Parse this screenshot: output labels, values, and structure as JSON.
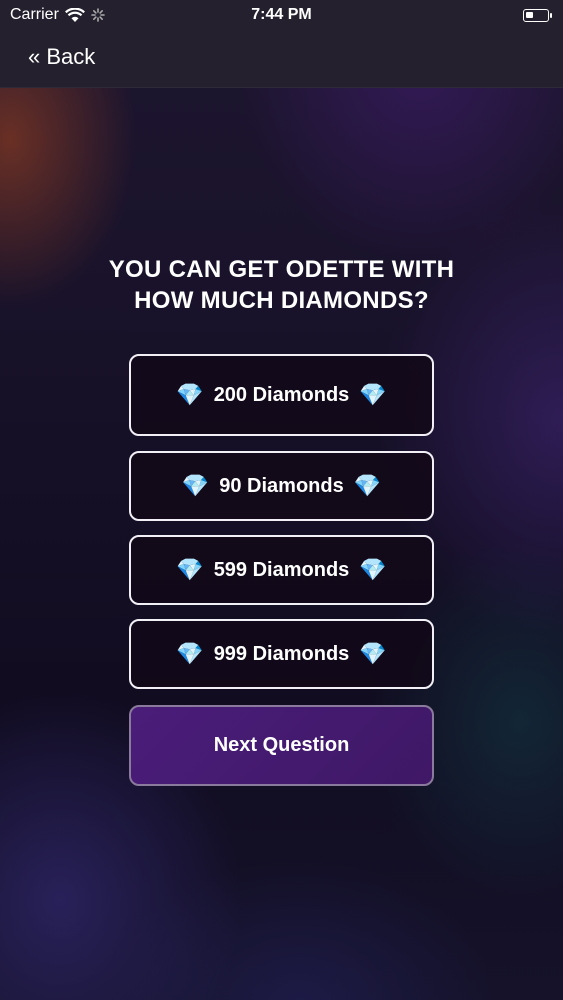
{
  "status_bar": {
    "carrier": "Carrier",
    "time": "7:44 PM"
  },
  "nav": {
    "back_label": "« Back"
  },
  "quiz": {
    "question": "YOU CAN GET ODETTE WITH HOW MUCH DIAMONDS?",
    "answers": [
      {
        "label": "200 Diamonds",
        "icon": "💎"
      },
      {
        "label": "90 Diamonds",
        "icon": "💎"
      },
      {
        "label": "599 Diamonds",
        "icon": "💎"
      },
      {
        "label": "999 Diamonds",
        "icon": "💎"
      }
    ],
    "next_label": "Next Question"
  },
  "colors": {
    "nav_background": "#24202e",
    "next_button": "#4a1d7a",
    "answer_border": "#f2f0f6"
  }
}
